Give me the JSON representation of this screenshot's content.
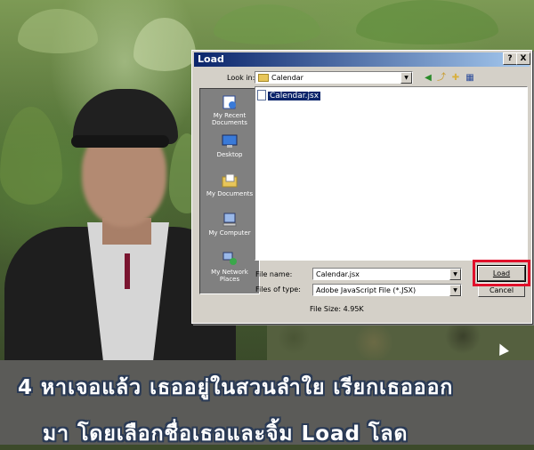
{
  "dialog": {
    "title": "Load",
    "help_glyph": "?",
    "close_glyph": "X",
    "look_in_label": "Look in:",
    "look_in_value": "Calendar",
    "places": [
      {
        "label": "My Recent Documents",
        "icon": "recent-documents-icon"
      },
      {
        "label": "Desktop",
        "icon": "desktop-icon"
      },
      {
        "label": "My Documents",
        "icon": "my-documents-icon"
      },
      {
        "label": "My Computer",
        "icon": "my-computer-icon"
      },
      {
        "label": "My Network Places",
        "icon": "network-places-icon"
      }
    ],
    "files": [
      {
        "name": "Calendar.jsx",
        "selected": true
      }
    ],
    "file_name_label": "File name:",
    "file_name_value": "Calendar.jsx",
    "files_of_type_label": "Files of type:",
    "files_of_type_value": "Adobe JavaScript File (*.JSX)",
    "load_button": "Load",
    "cancel_button": "Cancel",
    "file_size": "File Size: 4.95K",
    "titlebar_color": "#0a246a"
  },
  "caption": {
    "line1": "4 หาเจอแล้ว เธออยู่ในสวนลำใย เรียกเธอออก",
    "line2": "มา โดยเลือกชื่อเธอและจิ้ม Load โลด"
  },
  "highlight_color": "#e0102a"
}
